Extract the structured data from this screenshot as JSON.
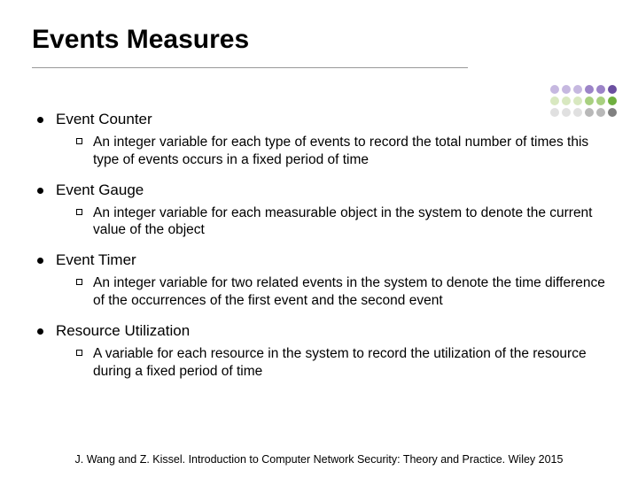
{
  "title": "Events Measures",
  "items": [
    {
      "heading": "Event Counter",
      "detail": "An integer variable for each type of events to record the total number of times this type of events occurs in a fixed period of time"
    },
    {
      "heading": "Event Gauge",
      "detail": "An integer variable for each measurable object in the system to denote the current value of the object"
    },
    {
      "heading": "Event Timer",
      "detail": "An integer variable for two related events in the system to denote the time difference of the occurrences of the first event and the second event"
    },
    {
      "heading": "Resource Utilization",
      "detail": "A variable for each resource in the system to record the utilization of the resource during a fixed period of time"
    }
  ],
  "footer": "J. Wang and Z. Kissel. Introduction to Computer Network Security: Theory and Practice. Wiley 2015",
  "dot_colors": [
    "#C6B8E0",
    "#C6B8E0",
    "#C6B8E0",
    "#9C84C8",
    "#9C84C8",
    "#6B4FA0",
    "#D8E8C0",
    "#D8E8C0",
    "#D8E8C0",
    "#A8D080",
    "#A8D080",
    "#6FAF3F",
    "#E0E0E0",
    "#E0E0E0",
    "#E0E0E0",
    "#B8B8B8",
    "#B8B8B8",
    "#808080"
  ]
}
